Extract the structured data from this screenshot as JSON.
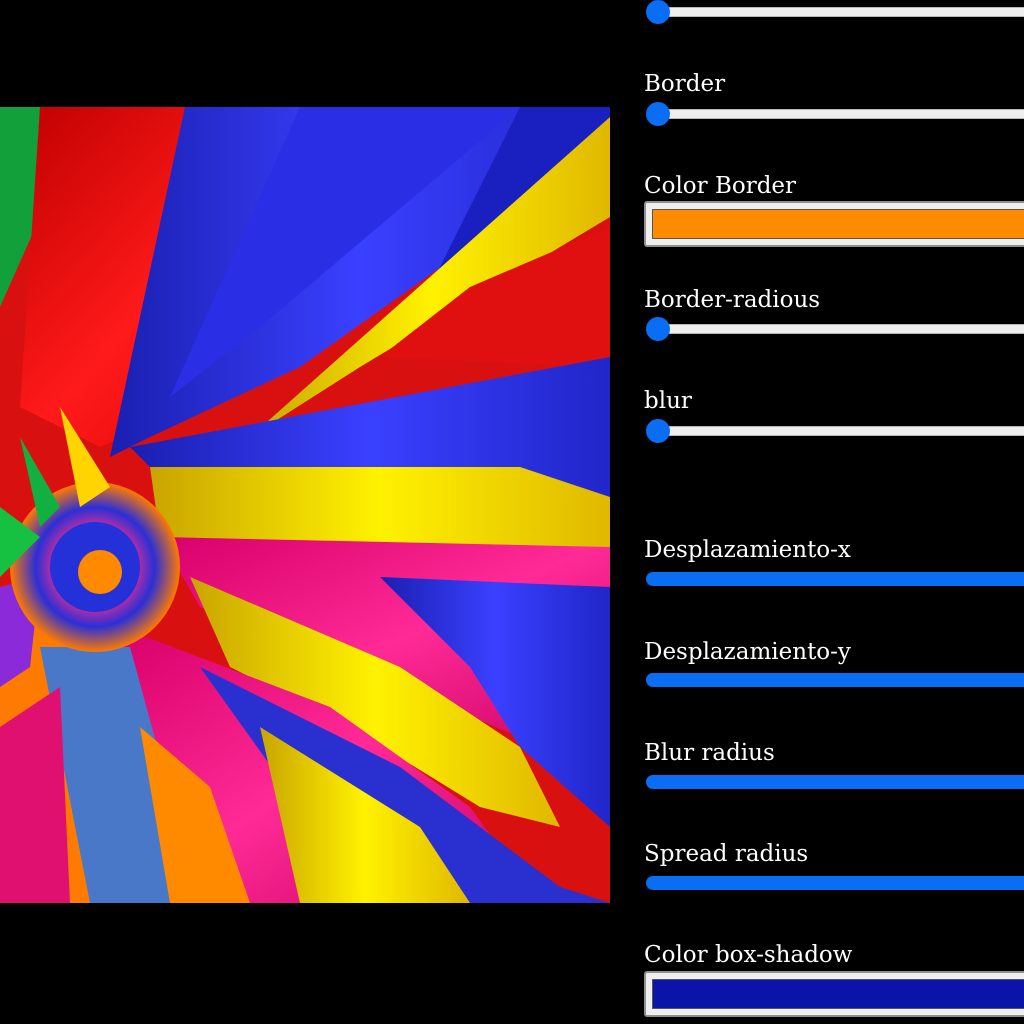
{
  "image": {
    "description_icon": "fractal-art-image"
  },
  "controls": {
    "top_slider": {
      "value": 0
    },
    "border": {
      "label": "Border",
      "value": 0
    },
    "color_border": {
      "label": "Color Border",
      "color": "#ff8c00"
    },
    "border_radius": {
      "label": "Border-radious",
      "value": 0
    },
    "blur": {
      "label": "blur",
      "value": 0
    },
    "desplazamiento_x": {
      "label": "Desplazamiento-x"
    },
    "desplazamiento_y": {
      "label": "Desplazamiento-y"
    },
    "blur_radius": {
      "label": "Blur radius"
    },
    "spread_radius": {
      "label": "Spread radius"
    },
    "color_box_shadow": {
      "label": "Color box-shadow",
      "color": "#0a14a8"
    }
  },
  "colors": {
    "background": "#000000",
    "accent": "#0a6ef5",
    "track": "#efefef"
  }
}
